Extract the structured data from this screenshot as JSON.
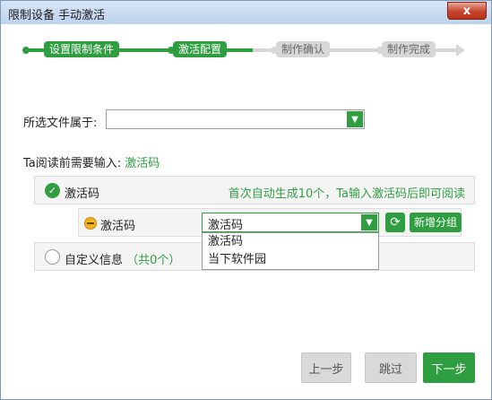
{
  "window": {
    "title": "限制设备 手动激活",
    "close_label": "x"
  },
  "steps": [
    {
      "label": "设置限制条件",
      "state": "done"
    },
    {
      "label": "激活配置",
      "state": "current"
    },
    {
      "label": "制作确认",
      "state": "todo"
    },
    {
      "label": "制作完成",
      "state": "todo"
    }
  ],
  "file_owner": {
    "label": "所选文件属于:",
    "value": ""
  },
  "input_prompt": {
    "prefix": "Ta阅读前需要输入:",
    "value": "激活码"
  },
  "options": {
    "activation": {
      "label": "激活码",
      "selected": true,
      "hint": "首次自动生成10个，Ta输入激活码后即可阅读"
    },
    "custom": {
      "label": "自定义信息",
      "count_text": "（共0个）",
      "selected": false
    }
  },
  "code_group": {
    "label": "激活码",
    "select_value": "激活码",
    "dropdown_items": [
      "激活码",
      "当下软件园"
    ],
    "add_group_label": "新增分组"
  },
  "footer": {
    "prev": "上一步",
    "skip": "跳过",
    "next": "下一步"
  },
  "colors": {
    "accent": "#2f9e41",
    "inactive": "#d7d7d7"
  }
}
